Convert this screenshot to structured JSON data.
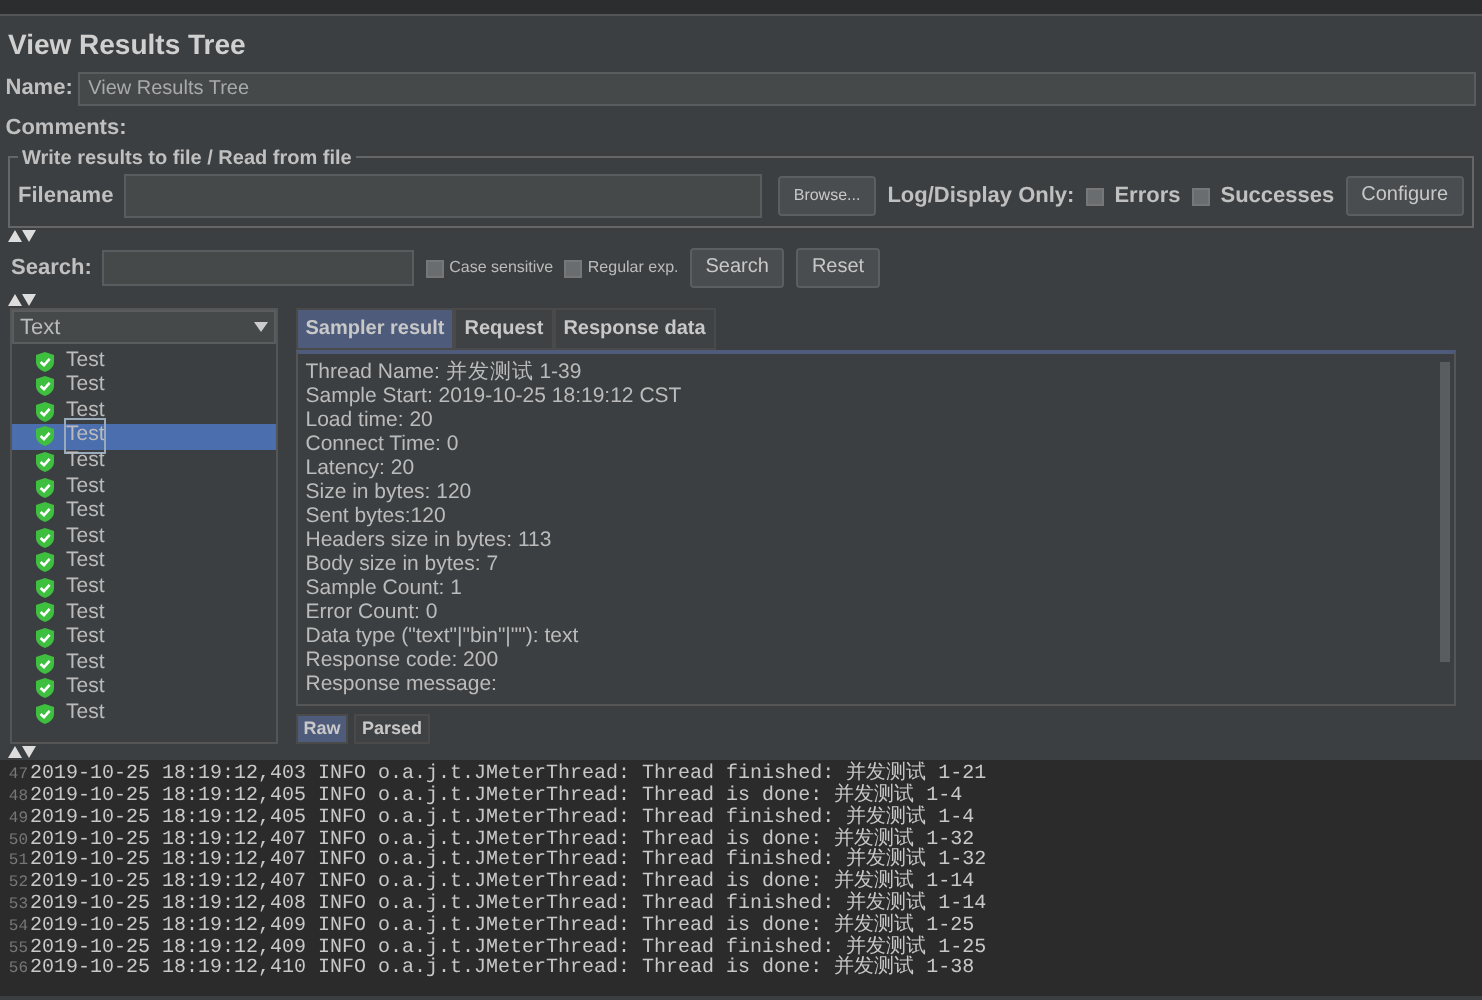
{
  "title": "View Results Tree",
  "name_field": {
    "label": "Name:",
    "value": "View Results Tree"
  },
  "comments": {
    "label": "Comments:"
  },
  "file_group": {
    "legend": "Write results to file / Read from file",
    "filename_label": "Filename",
    "browse_button": "Browse...",
    "log_label": "Log/Display Only:",
    "checkboxes": [
      {
        "label": "Errors",
        "checked": false
      },
      {
        "label": "Successes",
        "checked": false
      }
    ],
    "configure_button": "Configure"
  },
  "search": {
    "label": "Search:",
    "checkboxes": [
      {
        "label": "Case sensitive",
        "checked": false
      },
      {
        "label": "Regular exp.",
        "checked": false
      }
    ],
    "search_button": "Search",
    "reset_button": "Reset"
  },
  "renderer_select": {
    "value": "Text"
  },
  "tree": [
    {
      "label": "Test",
      "selected": false
    },
    {
      "label": "Test",
      "selected": false
    },
    {
      "label": "Test",
      "selected": false
    },
    {
      "label": "Test",
      "selected": true
    },
    {
      "label": "Test",
      "selected": false
    },
    {
      "label": "Test",
      "selected": false
    },
    {
      "label": "Test",
      "selected": false
    },
    {
      "label": "Test",
      "selected": false
    },
    {
      "label": "Test",
      "selected": false
    },
    {
      "label": "Test",
      "selected": false
    },
    {
      "label": "Test",
      "selected": false
    },
    {
      "label": "Test",
      "selected": false
    },
    {
      "label": "Test",
      "selected": false
    },
    {
      "label": "Test",
      "selected": false
    },
    {
      "label": "Test",
      "selected": false
    }
  ],
  "result_tabs": [
    {
      "label": "Sampler result",
      "selected": true
    },
    {
      "label": "Request",
      "selected": false
    },
    {
      "label": "Response data",
      "selected": false
    }
  ],
  "result_lines": [
    "Thread Name: 并发测试 1-39",
    "Sample Start: 2019-10-25 18:19:12 CST",
    "Load time: 20",
    "Connect Time: 0",
    "Latency: 20",
    "Size in bytes: 120",
    "Sent bytes:120",
    "Headers size in bytes: 113",
    "Body size in bytes: 7",
    "Sample Count: 1",
    "Error Count: 0",
    "Data type (\"text\"|\"bin\"|\"\"): text",
    "Response code: 200",
    "Response message:"
  ],
  "view_tabs": [
    {
      "label": "Raw",
      "selected": true
    },
    {
      "label": "Parsed",
      "selected": false
    }
  ],
  "log": [
    {
      "line": "47",
      "text": "2019-10-25 18:19:12,403 INFO o.a.j.t.JMeterThread: Thread finished: 并发测试 1-21"
    },
    {
      "line": "48",
      "text": "2019-10-25 18:19:12,405 INFO o.a.j.t.JMeterThread: Thread is done: 并发测试 1-4"
    },
    {
      "line": "49",
      "text": "2019-10-25 18:19:12,405 INFO o.a.j.t.JMeterThread: Thread finished: 并发测试 1-4"
    },
    {
      "line": "50",
      "text": "2019-10-25 18:19:12,407 INFO o.a.j.t.JMeterThread: Thread is done: 并发测试 1-32"
    },
    {
      "line": "51",
      "text": "2019-10-25 18:19:12,407 INFO o.a.j.t.JMeterThread: Thread finished: 并发测试 1-32"
    },
    {
      "line": "52",
      "text": "2019-10-25 18:19:12,407 INFO o.a.j.t.JMeterThread: Thread is done: 并发测试 1-14"
    },
    {
      "line": "53",
      "text": "2019-10-25 18:19:12,408 INFO o.a.j.t.JMeterThread: Thread finished: 并发测试 1-14"
    },
    {
      "line": "54",
      "text": "2019-10-25 18:19:12,409 INFO o.a.j.t.JMeterThread: Thread is done: 并发测试 1-25"
    },
    {
      "line": "55",
      "text": "2019-10-25 18:19:12,409 INFO o.a.j.t.JMeterThread: Thread finished: 并发测试 1-25"
    },
    {
      "line": "56",
      "text": "2019-10-25 18:19:12,410 INFO o.a.j.t.JMeterThread: Thread is done: 并发测试 1-38"
    }
  ]
}
